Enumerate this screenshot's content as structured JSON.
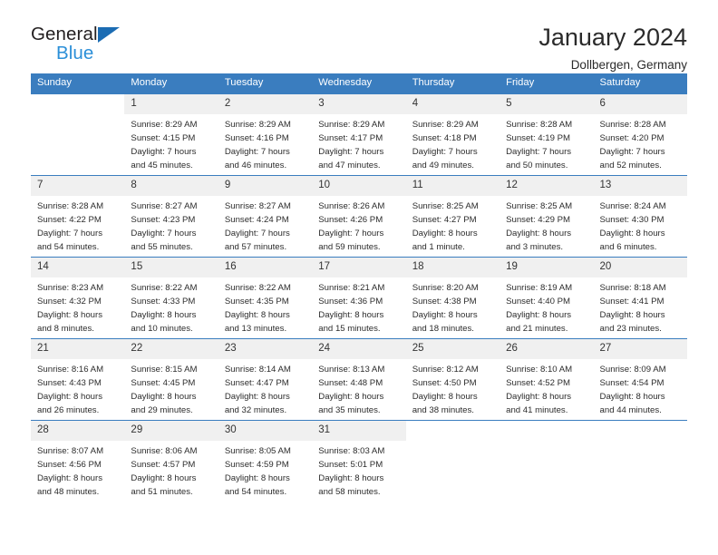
{
  "brand": {
    "name_part1": "General",
    "name_part2": "Blue",
    "triangle_color": "#1b6cb3",
    "blue_color": "#2b8fd8"
  },
  "header": {
    "title": "January 2024",
    "subtitle": "Dollbergen, Germany"
  },
  "theme": {
    "header_bg": "#3a7dbf",
    "header_text": "#ffffff",
    "daynum_bg": "#f0f0f0",
    "grid_line": "#3a7dbf"
  },
  "weekday_headers": [
    "Sunday",
    "Monday",
    "Tuesday",
    "Wednesday",
    "Thursday",
    "Friday",
    "Saturday"
  ],
  "weeks": [
    [
      {
        "day": "",
        "sunrise": "",
        "sunset": "",
        "daylight1": "",
        "daylight2": ""
      },
      {
        "day": "1",
        "sunrise": "Sunrise: 8:29 AM",
        "sunset": "Sunset: 4:15 PM",
        "daylight1": "Daylight: 7 hours",
        "daylight2": "and 45 minutes."
      },
      {
        "day": "2",
        "sunrise": "Sunrise: 8:29 AM",
        "sunset": "Sunset: 4:16 PM",
        "daylight1": "Daylight: 7 hours",
        "daylight2": "and 46 minutes."
      },
      {
        "day": "3",
        "sunrise": "Sunrise: 8:29 AM",
        "sunset": "Sunset: 4:17 PM",
        "daylight1": "Daylight: 7 hours",
        "daylight2": "and 47 minutes."
      },
      {
        "day": "4",
        "sunrise": "Sunrise: 8:29 AM",
        "sunset": "Sunset: 4:18 PM",
        "daylight1": "Daylight: 7 hours",
        "daylight2": "and 49 minutes."
      },
      {
        "day": "5",
        "sunrise": "Sunrise: 8:28 AM",
        "sunset": "Sunset: 4:19 PM",
        "daylight1": "Daylight: 7 hours",
        "daylight2": "and 50 minutes."
      },
      {
        "day": "6",
        "sunrise": "Sunrise: 8:28 AM",
        "sunset": "Sunset: 4:20 PM",
        "daylight1": "Daylight: 7 hours",
        "daylight2": "and 52 minutes."
      }
    ],
    [
      {
        "day": "7",
        "sunrise": "Sunrise: 8:28 AM",
        "sunset": "Sunset: 4:22 PM",
        "daylight1": "Daylight: 7 hours",
        "daylight2": "and 54 minutes."
      },
      {
        "day": "8",
        "sunrise": "Sunrise: 8:27 AM",
        "sunset": "Sunset: 4:23 PM",
        "daylight1": "Daylight: 7 hours",
        "daylight2": "and 55 minutes."
      },
      {
        "day": "9",
        "sunrise": "Sunrise: 8:27 AM",
        "sunset": "Sunset: 4:24 PM",
        "daylight1": "Daylight: 7 hours",
        "daylight2": "and 57 minutes."
      },
      {
        "day": "10",
        "sunrise": "Sunrise: 8:26 AM",
        "sunset": "Sunset: 4:26 PM",
        "daylight1": "Daylight: 7 hours",
        "daylight2": "and 59 minutes."
      },
      {
        "day": "11",
        "sunrise": "Sunrise: 8:25 AM",
        "sunset": "Sunset: 4:27 PM",
        "daylight1": "Daylight: 8 hours",
        "daylight2": "and 1 minute."
      },
      {
        "day": "12",
        "sunrise": "Sunrise: 8:25 AM",
        "sunset": "Sunset: 4:29 PM",
        "daylight1": "Daylight: 8 hours",
        "daylight2": "and 3 minutes."
      },
      {
        "day": "13",
        "sunrise": "Sunrise: 8:24 AM",
        "sunset": "Sunset: 4:30 PM",
        "daylight1": "Daylight: 8 hours",
        "daylight2": "and 6 minutes."
      }
    ],
    [
      {
        "day": "14",
        "sunrise": "Sunrise: 8:23 AM",
        "sunset": "Sunset: 4:32 PM",
        "daylight1": "Daylight: 8 hours",
        "daylight2": "and 8 minutes."
      },
      {
        "day": "15",
        "sunrise": "Sunrise: 8:22 AM",
        "sunset": "Sunset: 4:33 PM",
        "daylight1": "Daylight: 8 hours",
        "daylight2": "and 10 minutes."
      },
      {
        "day": "16",
        "sunrise": "Sunrise: 8:22 AM",
        "sunset": "Sunset: 4:35 PM",
        "daylight1": "Daylight: 8 hours",
        "daylight2": "and 13 minutes."
      },
      {
        "day": "17",
        "sunrise": "Sunrise: 8:21 AM",
        "sunset": "Sunset: 4:36 PM",
        "daylight1": "Daylight: 8 hours",
        "daylight2": "and 15 minutes."
      },
      {
        "day": "18",
        "sunrise": "Sunrise: 8:20 AM",
        "sunset": "Sunset: 4:38 PM",
        "daylight1": "Daylight: 8 hours",
        "daylight2": "and 18 minutes."
      },
      {
        "day": "19",
        "sunrise": "Sunrise: 8:19 AM",
        "sunset": "Sunset: 4:40 PM",
        "daylight1": "Daylight: 8 hours",
        "daylight2": "and 21 minutes."
      },
      {
        "day": "20",
        "sunrise": "Sunrise: 8:18 AM",
        "sunset": "Sunset: 4:41 PM",
        "daylight1": "Daylight: 8 hours",
        "daylight2": "and 23 minutes."
      }
    ],
    [
      {
        "day": "21",
        "sunrise": "Sunrise: 8:16 AM",
        "sunset": "Sunset: 4:43 PM",
        "daylight1": "Daylight: 8 hours",
        "daylight2": "and 26 minutes."
      },
      {
        "day": "22",
        "sunrise": "Sunrise: 8:15 AM",
        "sunset": "Sunset: 4:45 PM",
        "daylight1": "Daylight: 8 hours",
        "daylight2": "and 29 minutes."
      },
      {
        "day": "23",
        "sunrise": "Sunrise: 8:14 AM",
        "sunset": "Sunset: 4:47 PM",
        "daylight1": "Daylight: 8 hours",
        "daylight2": "and 32 minutes."
      },
      {
        "day": "24",
        "sunrise": "Sunrise: 8:13 AM",
        "sunset": "Sunset: 4:48 PM",
        "daylight1": "Daylight: 8 hours",
        "daylight2": "and 35 minutes."
      },
      {
        "day": "25",
        "sunrise": "Sunrise: 8:12 AM",
        "sunset": "Sunset: 4:50 PM",
        "daylight1": "Daylight: 8 hours",
        "daylight2": "and 38 minutes."
      },
      {
        "day": "26",
        "sunrise": "Sunrise: 8:10 AM",
        "sunset": "Sunset: 4:52 PM",
        "daylight1": "Daylight: 8 hours",
        "daylight2": "and 41 minutes."
      },
      {
        "day": "27",
        "sunrise": "Sunrise: 8:09 AM",
        "sunset": "Sunset: 4:54 PM",
        "daylight1": "Daylight: 8 hours",
        "daylight2": "and 44 minutes."
      }
    ],
    [
      {
        "day": "28",
        "sunrise": "Sunrise: 8:07 AM",
        "sunset": "Sunset: 4:56 PM",
        "daylight1": "Daylight: 8 hours",
        "daylight2": "and 48 minutes."
      },
      {
        "day": "29",
        "sunrise": "Sunrise: 8:06 AM",
        "sunset": "Sunset: 4:57 PM",
        "daylight1": "Daylight: 8 hours",
        "daylight2": "and 51 minutes."
      },
      {
        "day": "30",
        "sunrise": "Sunrise: 8:05 AM",
        "sunset": "Sunset: 4:59 PM",
        "daylight1": "Daylight: 8 hours",
        "daylight2": "and 54 minutes."
      },
      {
        "day": "31",
        "sunrise": "Sunrise: 8:03 AM",
        "sunset": "Sunset: 5:01 PM",
        "daylight1": "Daylight: 8 hours",
        "daylight2": "and 58 minutes."
      },
      {
        "day": "",
        "sunrise": "",
        "sunset": "",
        "daylight1": "",
        "daylight2": ""
      },
      {
        "day": "",
        "sunrise": "",
        "sunset": "",
        "daylight1": "",
        "daylight2": ""
      },
      {
        "day": "",
        "sunrise": "",
        "sunset": "",
        "daylight1": "",
        "daylight2": ""
      }
    ]
  ]
}
